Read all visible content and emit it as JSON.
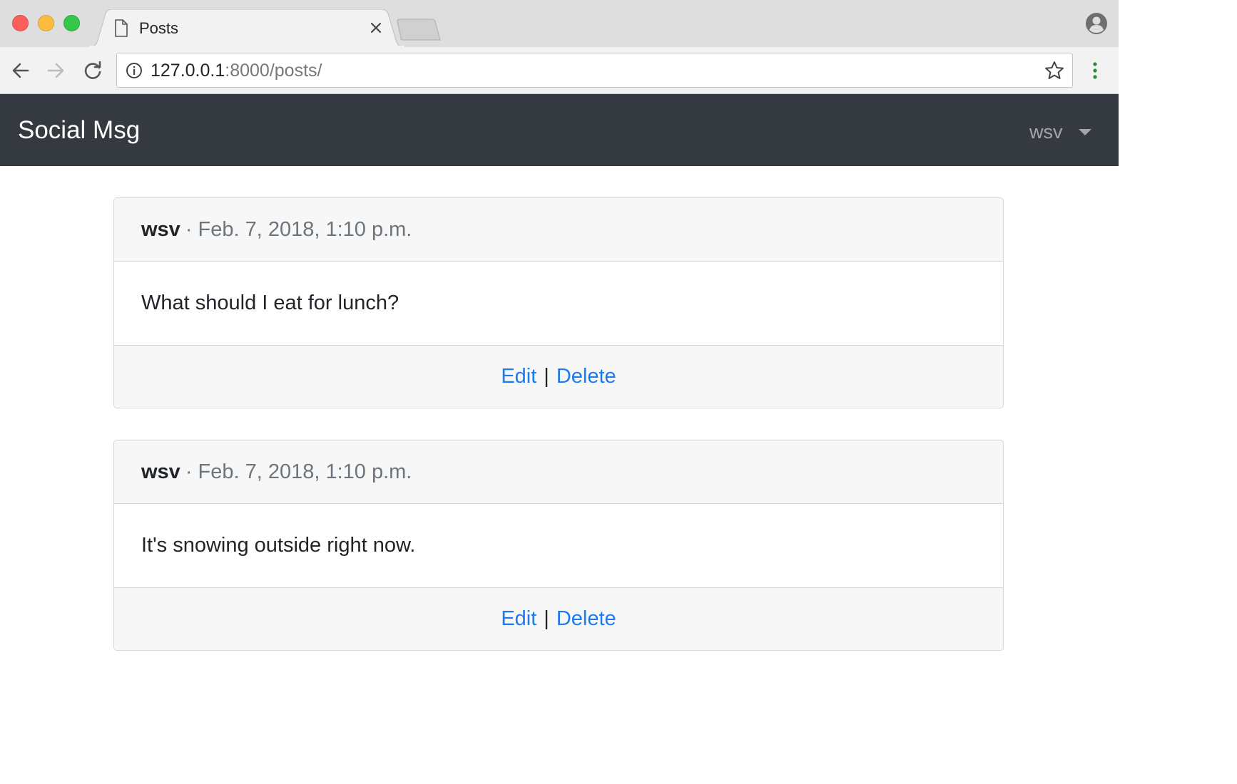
{
  "browser": {
    "tab_title": "Posts",
    "url_host": "127.0.0.1",
    "url_rest": ":8000/posts/"
  },
  "navbar": {
    "brand": "Social Msg",
    "user": "wsv"
  },
  "posts": [
    {
      "author": "wsv",
      "separator": "·",
      "date": "Feb. 7, 2018, 1:10 p.m.",
      "body": "What should I eat for lunch?",
      "edit_label": "Edit",
      "divider": "|",
      "delete_label": "Delete"
    },
    {
      "author": "wsv",
      "separator": "·",
      "date": "Feb. 7, 2018, 1:10 p.m.",
      "body": "It's snowing outside right now.",
      "edit_label": "Edit",
      "divider": "|",
      "delete_label": "Delete"
    }
  ],
  "colors": {
    "navbar_bg": "#343a40",
    "link": "#1a7bf2",
    "card_header_bg": "#f7f7f7"
  }
}
